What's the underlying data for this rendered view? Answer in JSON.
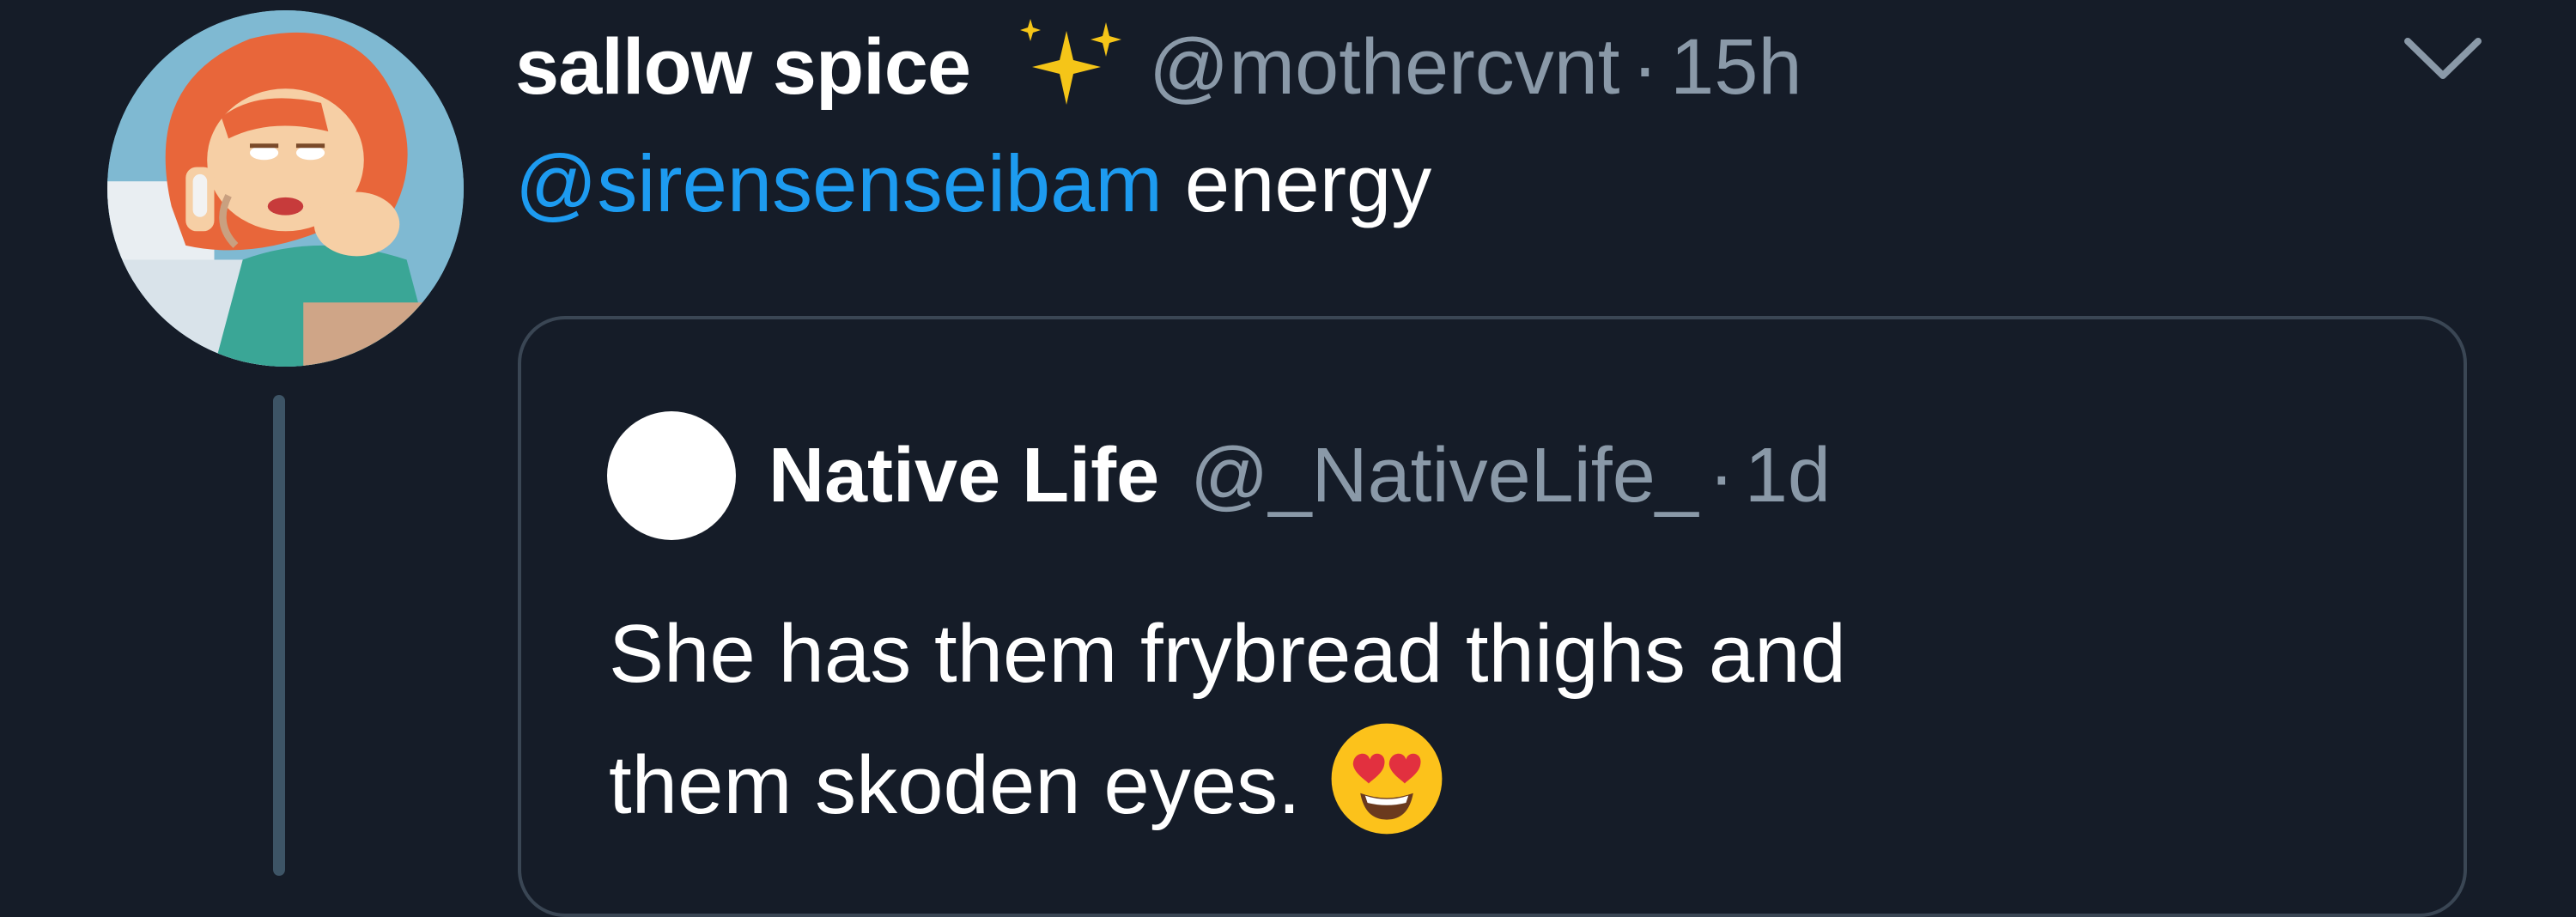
{
  "tweet": {
    "display_name": "sallow spice",
    "name_emoji": "sparkles-icon",
    "handle": "@mothercvnt",
    "separator": "·",
    "time": "15h",
    "mention": "@sirensenseibam",
    "text": "energy",
    "menu_icon": "chevron-down-icon"
  },
  "quoted_tweet": {
    "display_name": "Native Life",
    "handle": "@_NativeLife_",
    "separator": "·",
    "time": "1d",
    "text_line_1": "She has them frybread thighs and",
    "text_line_2": "them skoden eyes.",
    "emoji": "heart-eyes-emoji"
  },
  "colors": {
    "background": "#151c28",
    "mention": "#1d9bf0",
    "secondary_text": "#8a99a8",
    "card_border": "#3a4654",
    "thread_line": "#3d5466"
  }
}
